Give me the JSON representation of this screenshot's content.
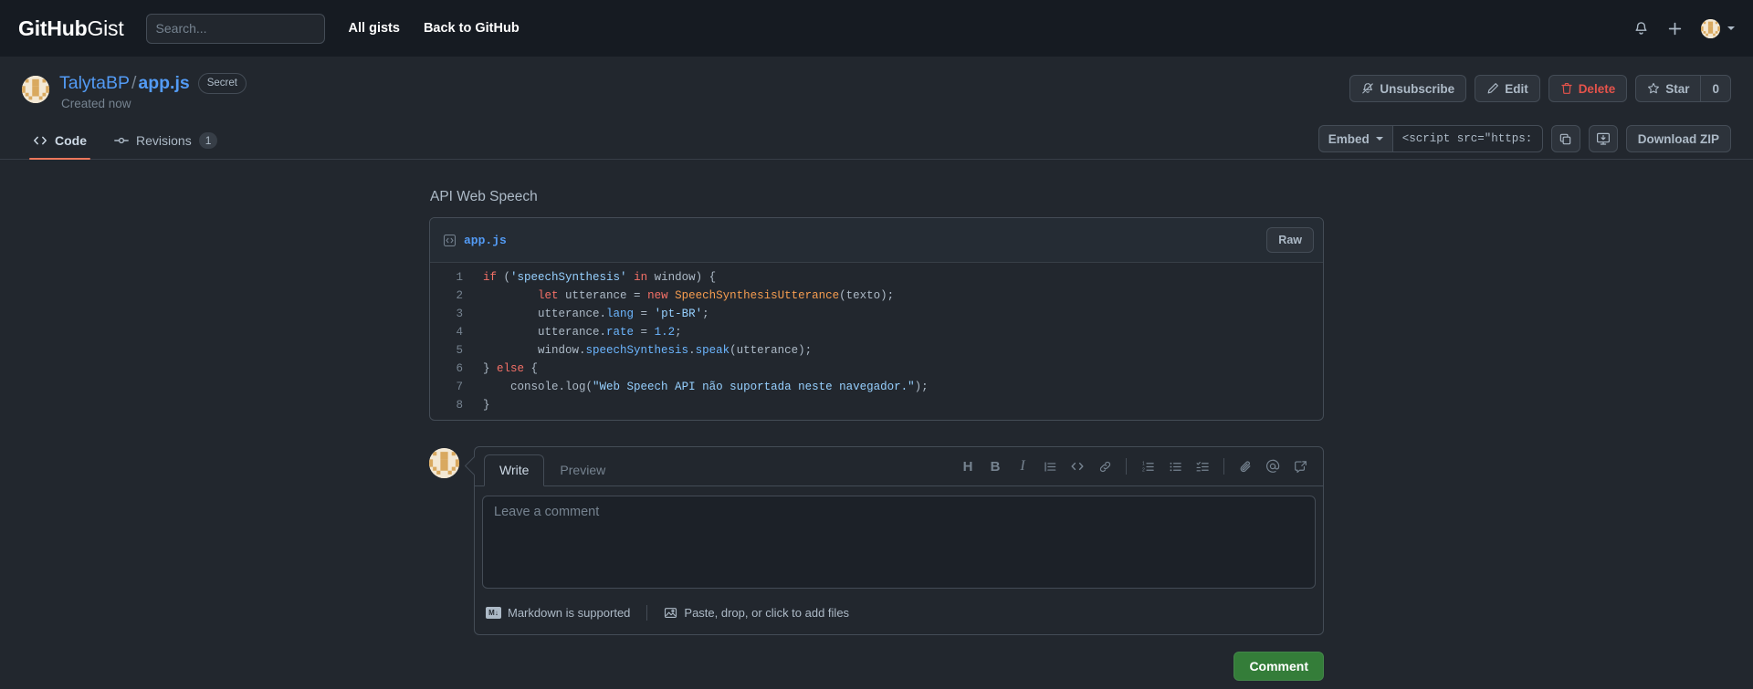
{
  "header": {
    "brand_bold": "GitHub",
    "brand_light": "Gist",
    "search_placeholder": "Search...",
    "search_value": "",
    "links": [
      {
        "label": "All gists",
        "name": "all-gists-link"
      },
      {
        "label": "Back to GitHub",
        "name": "back-to-github-link"
      }
    ],
    "icons": {
      "search": "search-icon",
      "bell": "notifications-bell-icon",
      "plus": "create-new-icon",
      "avatar": "user-avatar",
      "caret": "chevron-down-icon"
    }
  },
  "gist": {
    "owner": "TalytaBP",
    "separator": "/",
    "filename": "app.js",
    "visibility_badge": "Secret",
    "created": "Created now",
    "actions": {
      "unsubscribe": "Unsubscribe",
      "edit": "Edit",
      "delete": "Delete",
      "star": "Star",
      "star_count": "0"
    }
  },
  "tabnav": {
    "tabs": [
      {
        "label": "Code",
        "icon": "code-icon",
        "count": "",
        "active": true
      },
      {
        "label": "Revisions",
        "icon": "git-commit-icon",
        "count": "1",
        "active": false
      }
    ],
    "embed": {
      "select_label": "Embed",
      "url_value": "<script src=\"https://g",
      "copy_icon": "copy-icon",
      "open_desktop_icon": "open-with-desktop-icon",
      "download_label": "Download ZIP"
    }
  },
  "main": {
    "description": "API Web Speech",
    "file": {
      "icon": "code-file-icon",
      "name": "app.js",
      "raw_label": "Raw",
      "lines": [
        {
          "n": "1",
          "tokens": [
            {
              "t": "if ",
              "c": "k"
            },
            {
              "t": "(",
              "c": "c"
            },
            {
              "t": "'speechSynthesis'",
              "c": "s"
            },
            {
              "t": " in ",
              "c": "k"
            },
            {
              "t": "window",
              "c": "c"
            },
            {
              "t": ") {",
              "c": "c"
            }
          ]
        },
        {
          "n": "2",
          "tokens": [
            {
              "t": "        ",
              "c": "c"
            },
            {
              "t": "let",
              "c": "k"
            },
            {
              "t": " utterance ",
              "c": "c"
            },
            {
              "t": "=",
              "c": "c"
            },
            {
              "t": " new ",
              "c": "k"
            },
            {
              "t": "SpeechSynthesisUtterance",
              "c": "e"
            },
            {
              "t": "(texto);",
              "c": "c"
            }
          ]
        },
        {
          "n": "3",
          "tokens": [
            {
              "t": "        utterance.",
              "c": "c"
            },
            {
              "t": "lang",
              "c": "v"
            },
            {
              "t": " = ",
              "c": "c"
            },
            {
              "t": "'pt-BR'",
              "c": "s"
            },
            {
              "t": ";",
              "c": "c"
            }
          ]
        },
        {
          "n": "4",
          "tokens": [
            {
              "t": "        utterance.",
              "c": "c"
            },
            {
              "t": "rate",
              "c": "v"
            },
            {
              "t": " = ",
              "c": "c"
            },
            {
              "t": "1.2",
              "c": "v"
            },
            {
              "t": ";",
              "c": "c"
            }
          ]
        },
        {
          "n": "5",
          "tokens": [
            {
              "t": "        window.",
              "c": "c"
            },
            {
              "t": "speechSynthesis",
              "c": "v"
            },
            {
              "t": ".",
              "c": "c"
            },
            {
              "t": "speak",
              "c": "v"
            },
            {
              "t": "(utterance);",
              "c": "c"
            }
          ]
        },
        {
          "n": "6",
          "tokens": [
            {
              "t": "} ",
              "c": "c"
            },
            {
              "t": "else",
              "c": "k"
            },
            {
              "t": " {",
              "c": "c"
            }
          ]
        },
        {
          "n": "7",
          "tokens": [
            {
              "t": "    console.",
              "c": "c"
            },
            {
              "t": "log",
              "c": "c"
            },
            {
              "t": "(",
              "c": "c"
            },
            {
              "t": "\"Web Speech API não suportada neste navegador.\"",
              "c": "s"
            },
            {
              "t": ");",
              "c": "c"
            }
          ]
        },
        {
          "n": "8",
          "tokens": [
            {
              "t": "}",
              "c": "c"
            }
          ]
        }
      ]
    },
    "comment_form": {
      "avatar": "user-avatar",
      "tabs": [
        {
          "label": "Write",
          "active": true
        },
        {
          "label": "Preview",
          "active": false
        }
      ],
      "toolbar": [
        {
          "name": "heading-icon",
          "glyph": "H"
        },
        {
          "name": "bold-icon",
          "glyph": "B"
        },
        {
          "name": "italic-icon",
          "glyph": "I"
        },
        {
          "name": "quote-icon",
          "glyph": ""
        },
        {
          "name": "code-icon",
          "glyph": "<>"
        },
        {
          "name": "link-icon",
          "glyph": ""
        },
        {
          "name": "ordered-list-icon",
          "glyph": ""
        },
        {
          "name": "unordered-list-icon",
          "glyph": ""
        },
        {
          "name": "task-list-icon",
          "glyph": ""
        },
        {
          "name": "attach-file-icon",
          "glyph": ""
        },
        {
          "name": "mention-icon",
          "glyph": "@"
        },
        {
          "name": "saved-replies-icon",
          "glyph": ""
        }
      ],
      "textarea_placeholder": "Leave a comment",
      "textarea_value": "",
      "footer": {
        "markdown_label": "Markdown is supported",
        "markdown_badge": "M↓",
        "attach_label": "Paste, drop, or click to add files"
      },
      "submit_label": "Comment"
    }
  },
  "colors": {
    "page_bg": "#22272e",
    "header_bg": "#161b22",
    "border": "#444c56",
    "accent_link": "#539bf5",
    "tab_underline": "#ec775c",
    "danger": "#e5534b",
    "primary_btn": "#347d39",
    "muted_text": "#768390"
  }
}
